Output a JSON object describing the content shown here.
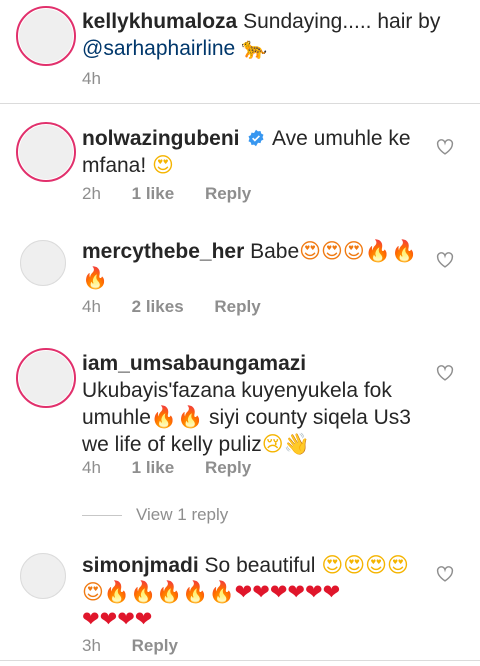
{
  "caption": {
    "username": "kellykhumaloza",
    "text": "Sundaying..... hair by",
    "mention": "@sarhaphairline",
    "emoji": "🐆",
    "time": "4h"
  },
  "comments": [
    {
      "username": "nolwazingubeni",
      "verified": true,
      "text_line1": "Ave umuhle ke",
      "text_line2": "mfana!",
      "emoji": "😍",
      "time": "2h",
      "likes": "1 like",
      "reply": "Reply"
    },
    {
      "username": "mercythebe_her",
      "text": "Babe",
      "emoji_line1": "😍😍😍🔥🔥",
      "emoji_line2": "🔥",
      "time": "4h",
      "likes": "2 likes",
      "reply": "Reply"
    },
    {
      "username": "iam_umsabaungamazi",
      "text_line1": "Ukubayis'fazana kuyenyukela fok",
      "text_line2a": "umuhle",
      "emoji_a": "🔥🔥",
      "text_line2b": "siyi county siqela Us3",
      "text_line3": "we life of kelly puliz",
      "emoji_b": "😢👋",
      "time": "4h",
      "likes": "1 like",
      "reply": "Reply",
      "view_replies": "View 1 reply"
    },
    {
      "username": "simonjmadi",
      "text": "So beautiful",
      "emoji_line1": "😍😍😍😍",
      "emoji_line2a": "😍🔥🔥🔥🔥🔥",
      "emoji_line2b": "❤❤❤❤❤❤",
      "emoji_line3": "❤❤❤❤",
      "time": "3h",
      "reply": "Reply"
    }
  ]
}
